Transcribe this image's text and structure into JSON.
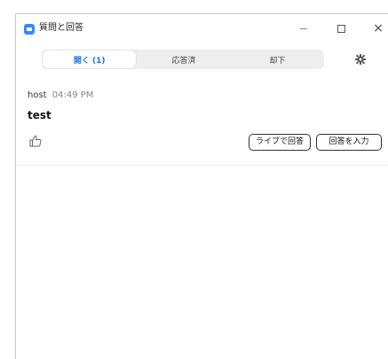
{
  "window": {
    "title": "質問と回答",
    "close_glyph": "×"
  },
  "tabs": [
    {
      "label": "開く (1)",
      "active": true
    },
    {
      "label": "応答済",
      "active": false
    },
    {
      "label": "却下",
      "active": false
    }
  ],
  "question": {
    "author": "host",
    "time": "04:49 PM",
    "text": "test",
    "actions": {
      "answer_live": "ライブで回答",
      "type_answer": "回答を入力"
    }
  },
  "colors": {
    "accent": "#1a73e8",
    "app_icon": "#2d8cff"
  },
  "icons": [
    "zoom-app-icon",
    "minimize-icon",
    "maximize-icon",
    "close-icon",
    "gear-icon",
    "thumbs-up-icon"
  ]
}
